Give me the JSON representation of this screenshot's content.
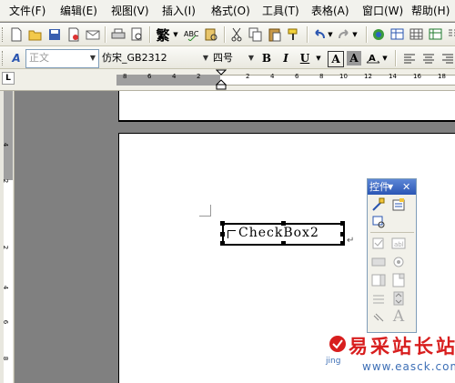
{
  "menu": [
    "文件(F)",
    "编辑(E)",
    "视图(V)",
    "插入(I)",
    "格式(O)",
    "工具(T)",
    "表格(A)",
    "窗口(W)",
    "帮助(H)"
  ],
  "format_toolbar": {
    "style_value": "正文",
    "font_value": "仿宋_GB2312",
    "size_value": "四号",
    "bold": "B",
    "italic": "I",
    "underline": "U",
    "char_border": "A",
    "char_shade": "A"
  },
  "standard_toolbar": {
    "trad_chinese": "繁"
  },
  "ruler": {
    "tab_selector": "L",
    "numbers": [
      "8",
      "6",
      "4",
      "2",
      "2",
      "4",
      "6",
      "8",
      "10",
      "12",
      "14",
      "16",
      "18"
    ],
    "vnumbers": [
      "4",
      "2",
      "2",
      "4",
      "6",
      "8"
    ]
  },
  "document": {
    "checkbox_caption": "CheckBox2"
  },
  "control_toolbox": {
    "title": "控件",
    "tools": [
      "design-mode",
      "properties",
      "view-code",
      "checkbox",
      "textbox",
      "command-button",
      "option-button",
      "listbox",
      "combobox",
      "toggle-button",
      "spin-button",
      "scrollbar",
      "label"
    ]
  },
  "watermark": {
    "cn": "易采站长站",
    "url": "www.easck.com",
    "small": "jing"
  },
  "colors": {
    "menubar": "#f2f2ed",
    "workspace": "#808080",
    "watermark_red": "#d81e1e",
    "watermark_blue": "#3d6fb6"
  }
}
